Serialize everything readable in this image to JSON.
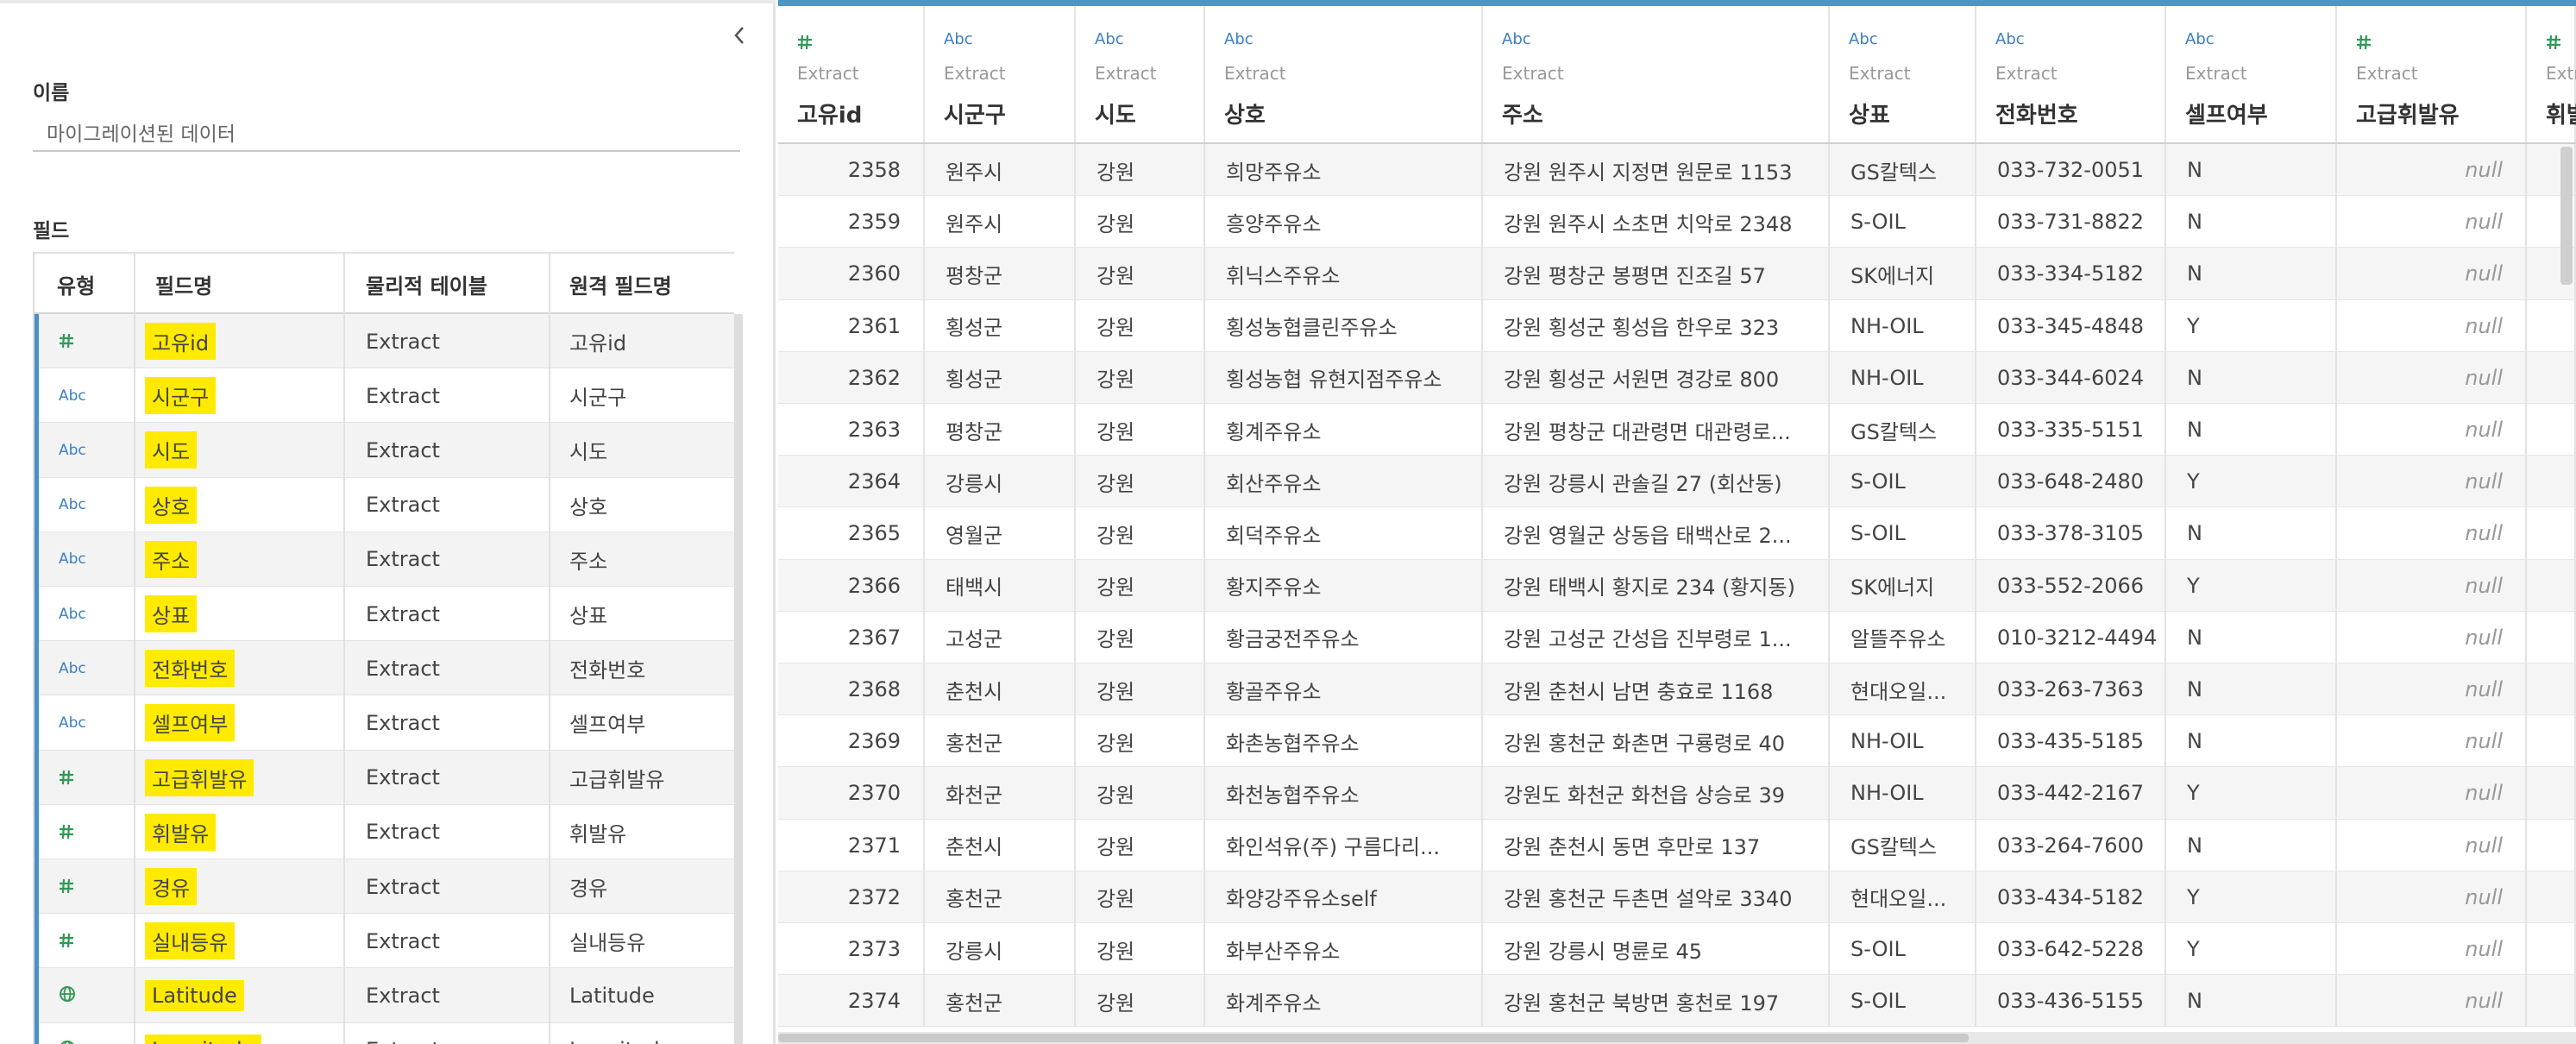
{
  "left_panel": {
    "name_label": "이름",
    "name_value": "마이그레이션된 데이터",
    "fields_label": "필드",
    "columns": [
      "유형",
      "필드명",
      "물리적 테이블",
      "원격 필드명"
    ],
    "fields": [
      {
        "type": "#",
        "type_icon": "number-icon",
        "name": "고유id",
        "table": "Extract",
        "remote": "고유id"
      },
      {
        "type": "Abc",
        "type_icon": "string-icon",
        "name": "시군구",
        "table": "Extract",
        "remote": "시군구"
      },
      {
        "type": "Abc",
        "type_icon": "string-icon",
        "name": "시도",
        "table": "Extract",
        "remote": "시도"
      },
      {
        "type": "Abc",
        "type_icon": "string-icon",
        "name": "상호",
        "table": "Extract",
        "remote": "상호"
      },
      {
        "type": "Abc",
        "type_icon": "string-icon",
        "name": "주소",
        "table": "Extract",
        "remote": "주소"
      },
      {
        "type": "Abc",
        "type_icon": "string-icon",
        "name": "상표",
        "table": "Extract",
        "remote": "상표"
      },
      {
        "type": "Abc",
        "type_icon": "string-icon",
        "name": "전화번호",
        "table": "Extract",
        "remote": "전화번호"
      },
      {
        "type": "Abc",
        "type_icon": "string-icon",
        "name": "셀프여부",
        "table": "Extract",
        "remote": "셀프여부"
      },
      {
        "type": "#",
        "type_icon": "number-icon",
        "name": "고급휘발유",
        "table": "Extract",
        "remote": "고급휘발유"
      },
      {
        "type": "#",
        "type_icon": "number-icon",
        "name": "휘발유",
        "table": "Extract",
        "remote": "휘발유"
      },
      {
        "type": "#",
        "type_icon": "number-icon",
        "name": "경유",
        "table": "Extract",
        "remote": "경유"
      },
      {
        "type": "#",
        "type_icon": "number-icon",
        "name": "실내등유",
        "table": "Extract",
        "remote": "실내등유"
      },
      {
        "type": "globe",
        "type_icon": "globe-icon",
        "name": "Latitude",
        "table": "Extract",
        "remote": "Latitude"
      },
      {
        "type": "globe",
        "type_icon": "globe-icon",
        "name": "Longitude",
        "table": "Extract",
        "remote": "Longitude"
      }
    ]
  },
  "data_grid": {
    "columns": [
      {
        "type": "#",
        "type_icon": "number-icon",
        "source": "Extract",
        "name": "고유id"
      },
      {
        "type": "Abc",
        "type_icon": "string-icon",
        "source": "Extract",
        "name": "시군구"
      },
      {
        "type": "Abc",
        "type_icon": "string-icon",
        "source": "Extract",
        "name": "시도"
      },
      {
        "type": "Abc",
        "type_icon": "string-icon",
        "source": "Extract",
        "name": "상호"
      },
      {
        "type": "Abc",
        "type_icon": "string-icon",
        "source": "Extract",
        "name": "주소"
      },
      {
        "type": "Abc",
        "type_icon": "string-icon",
        "source": "Extract",
        "name": "상표"
      },
      {
        "type": "Abc",
        "type_icon": "string-icon",
        "source": "Extract",
        "name": "전화번호"
      },
      {
        "type": "Abc",
        "type_icon": "string-icon",
        "source": "Extract",
        "name": "셀프여부"
      },
      {
        "type": "#",
        "type_icon": "number-icon",
        "source": "Extract",
        "name": "고급휘발유"
      },
      {
        "type": "#",
        "type_icon": "number-icon",
        "source": "Extract",
        "name": "휘발"
      }
    ],
    "rows": [
      [
        "2358",
        "원주시",
        "강원",
        "희망주유소",
        "강원 원주시 지정면 원문로 1153",
        "GS칼텍스",
        "033-732-0051",
        "N",
        "null"
      ],
      [
        "2359",
        "원주시",
        "강원",
        "흥양주유소",
        "강원 원주시 소초면 치악로 2348",
        "S-OIL",
        "033-731-8822",
        "N",
        "null"
      ],
      [
        "2360",
        "평창군",
        "강원",
        "휘닉스주유소",
        "강원 평창군 봉평면 진조길 57",
        "SK에너지",
        "033-334-5182",
        "N",
        "null"
      ],
      [
        "2361",
        "횡성군",
        "강원",
        "횡성농협클린주유소",
        "강원 횡성군 횡성읍 한우로 323",
        "NH-OIL",
        "033-345-4848",
        "Y",
        "null"
      ],
      [
        "2362",
        "횡성군",
        "강원",
        "횡성농협 유현지점주유소",
        "강원 횡성군 서원면 경강로 800",
        "NH-OIL",
        "033-344-6024",
        "N",
        "null"
      ],
      [
        "2363",
        "평창군",
        "강원",
        "횡계주유소",
        "강원 평창군 대관령면 대관령로...",
        "GS칼텍스",
        "033-335-5151",
        "N",
        "null"
      ],
      [
        "2364",
        "강릉시",
        "강원",
        "회산주유소",
        "강원 강릉시 관솔길 27 (회산동)",
        "S-OIL",
        "033-648-2480",
        "Y",
        "null"
      ],
      [
        "2365",
        "영월군",
        "강원",
        "회덕주유소",
        "강원 영월군 상동읍 태백산로 2...",
        "S-OIL",
        "033-378-3105",
        "N",
        "null"
      ],
      [
        "2366",
        "태백시",
        "강원",
        "황지주유소",
        "강원 태백시 황지로 234 (황지동)",
        "SK에너지",
        "033-552-2066",
        "Y",
        "null"
      ],
      [
        "2367",
        "고성군",
        "강원",
        "황금궁전주유소",
        "강원 고성군 간성읍 진부령로 1...",
        "알뜰주유소",
        "010-3212-4494",
        "N",
        "null"
      ],
      [
        "2368",
        "춘천시",
        "강원",
        "황골주유소",
        "강원 춘천시 남면 충효로 1168",
        "현대오일...",
        "033-263-7363",
        "N",
        "null"
      ],
      [
        "2369",
        "홍천군",
        "강원",
        "화촌농협주유소",
        "강원 홍천군 화촌면 구룡령로 40",
        "NH-OIL",
        "033-435-5185",
        "N",
        "null"
      ],
      [
        "2370",
        "화천군",
        "강원",
        "화천농협주유소",
        " 강원도 화천군 화천읍 상승로 39",
        "NH-OIL",
        "033-442-2167",
        "Y",
        "null"
      ],
      [
        "2371",
        "춘천시",
        "강원",
        "화인석유(주) 구름다리...",
        "강원 춘천시 동면 후만로 137",
        "GS칼텍스",
        "033-264-7600",
        "N",
        "null"
      ],
      [
        "2372",
        "홍천군",
        "강원",
        "화양강주유소self",
        "강원 홍천군 두촌면 설악로 3340",
        "현대오일...",
        "033-434-5182",
        "Y",
        "null"
      ],
      [
        "2373",
        "강릉시",
        "강원",
        "화부산주유소",
        "강원 강릉시 명륜로 45",
        "S-OIL",
        "033-642-5228",
        "Y",
        "null"
      ],
      [
        "2374",
        "홍천군",
        "강원",
        "화계주유소",
        "강원 홍천군 북방면 홍천로 197",
        "S-OIL",
        "033-436-5155",
        "N",
        "null"
      ]
    ]
  },
  "colors": {
    "accent_blue": "#4996c8",
    "number_green": "#2f9a55",
    "string_blue": "#3b7fc4",
    "highlight": "#ffea00"
  }
}
